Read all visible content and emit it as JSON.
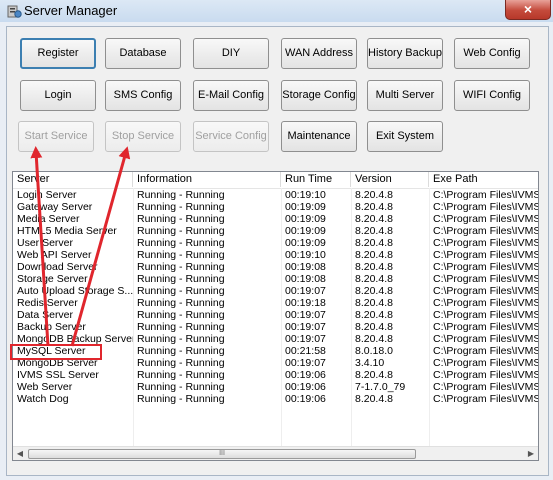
{
  "window": {
    "title": "Server Manager",
    "close_label": "×"
  },
  "buttons": {
    "row1": [
      "Register",
      "Database",
      "DIY",
      "WAN Address",
      "History Backup",
      "Web Config"
    ],
    "row2": [
      "Login",
      "SMS Config",
      "E-Mail Config",
      "Storage Config",
      "Multi Server",
      "WIFI Config"
    ],
    "row3": [
      "Start Service",
      "Stop Service",
      "Service Config",
      "Maintenance",
      "Exit System"
    ]
  },
  "table": {
    "headers": [
      "Server",
      "Information",
      "Run Time",
      "Version",
      "Exe Path"
    ],
    "rows": [
      [
        "Login Server",
        "Running - Running",
        "00:19:10",
        "8.20.4.8",
        "C:\\Program Files\\IVMS Se"
      ],
      [
        "Gateway Server",
        "Running - Running",
        "00:19:09",
        "8.20.4.8",
        "C:\\Program Files\\IVMS Se"
      ],
      [
        "Media Server",
        "Running - Running",
        "00:19:09",
        "8.20.4.8",
        "C:\\Program Files\\IVMS Se"
      ],
      [
        "HTML5 Media Server",
        "Running - Running",
        "00:19:09",
        "8.20.4.8",
        "C:\\Program Files\\IVMS Se"
      ],
      [
        "User Server",
        "Running - Running",
        "00:19:09",
        "8.20.4.8",
        "C:\\Program Files\\IVMS Se"
      ],
      [
        "Web API Server",
        "Running - Running",
        "00:19:10",
        "8.20.4.8",
        "C:\\Program Files\\IVMS Se"
      ],
      [
        "Download Server",
        "Running - Running",
        "00:19:08",
        "8.20.4.8",
        "C:\\Program Files\\IVMS Se"
      ],
      [
        "Storage Server",
        "Running - Running",
        "00:19:08",
        "8.20.4.8",
        "C:\\Program Files\\IVMS Se"
      ],
      [
        "Auto Upload Storage S...",
        "Running - Running",
        "00:19:07",
        "8.20.4.8",
        "C:\\Program Files\\IVMS Se"
      ],
      [
        "Redis Server",
        "Running - Running",
        "00:19:18",
        "8.20.4.8",
        "C:\\Program Files\\IVMS Se"
      ],
      [
        "Data Server",
        "Running - Running",
        "00:19:07",
        "8.20.4.8",
        "C:\\Program Files\\IVMS Se"
      ],
      [
        "Backup Server",
        "Running - Running",
        "00:19:07",
        "8.20.4.8",
        "C:\\Program Files\\IVMS Se"
      ],
      [
        "MongoDB Backup Server",
        "Running - Running",
        "00:19:07",
        "8.20.4.8",
        "C:\\Program Files\\IVMS Se"
      ],
      [
        "MySQL Server",
        "Running - Running",
        "00:21:58",
        "8.0.18.0",
        "C:\\Program Files\\IVMS Se"
      ],
      [
        "MongoDB Server",
        "Running - Running",
        "00:19:07",
        "3.4.10",
        "C:\\Program Files\\IVMS Se"
      ],
      [
        "IVMS SSL Server",
        "Running - Running",
        "00:19:06",
        "8.20.4.8",
        "C:\\Program Files\\IVMS Se"
      ],
      [
        "Web Server",
        "Running - Running",
        "00:19:06",
        "7-1.7.0_79",
        "C:\\Program Files\\IVMS Se"
      ],
      [
        "Watch Dog",
        "Running - Running",
        "00:19:06",
        "8.20.4.8",
        "C:\\Program Files\\IVMS Se"
      ]
    ]
  },
  "scrollbar": {
    "left_arrow": "◀",
    "right_arrow": "▶",
    "thumb_grip": "III"
  },
  "annotation": {
    "highlight_color": "#e0262d",
    "highlighted_row": "MySQL Server"
  }
}
